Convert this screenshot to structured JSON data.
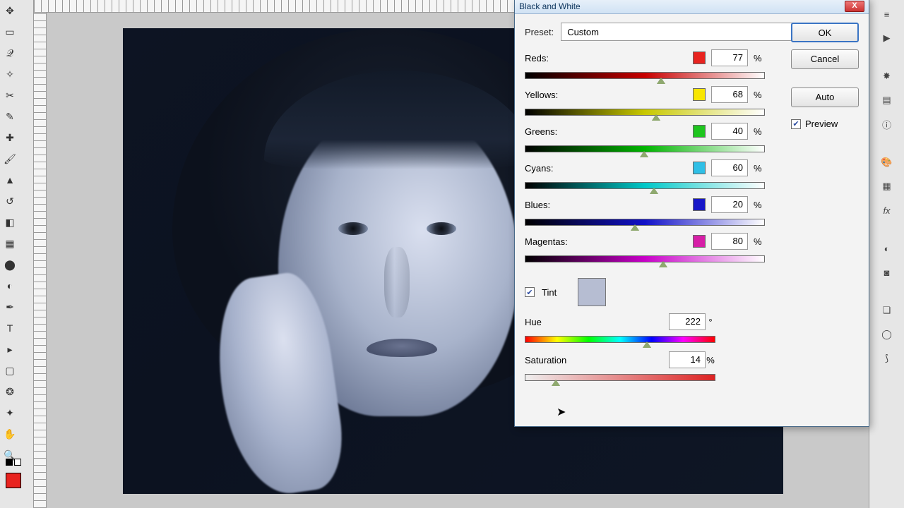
{
  "dialog": {
    "title": "Black and White",
    "preset_label": "Preset:",
    "preset_value": "Custom",
    "buttons": {
      "ok": "OK",
      "cancel": "Cancel",
      "auto": "Auto"
    },
    "preview_label": "Preview",
    "preview_checked": true,
    "channels": [
      {
        "label": "Reds:",
        "color": "#e8231f",
        "value": "77",
        "grad": "grad-red",
        "pos": 55
      },
      {
        "label": "Yellows:",
        "color": "#f8e600",
        "value": "68",
        "grad": "grad-yellow",
        "pos": 53
      },
      {
        "label": "Greens:",
        "color": "#1ec51e",
        "value": "40",
        "grad": "grad-green",
        "pos": 48
      },
      {
        "label": "Cyans:",
        "color": "#2fbfe6",
        "value": "60",
        "grad": "grad-cyan",
        "pos": 52
      },
      {
        "label": "Blues:",
        "color": "#1616c8",
        "value": "20",
        "grad": "grad-blue",
        "pos": 44
      },
      {
        "label": "Magentas:",
        "color": "#d61ea7",
        "value": "80",
        "grad": "grad-mag",
        "pos": 56
      }
    ],
    "percent": "%",
    "tint": {
      "label": "Tint",
      "checked": true,
      "swatch": "#b6bdd2"
    },
    "hue": {
      "label": "Hue",
      "value": "222",
      "unit": "°",
      "pos": 62
    },
    "saturation": {
      "label": "Saturation",
      "value": "14",
      "unit": "%",
      "pos": 14,
      "selected": true
    }
  }
}
